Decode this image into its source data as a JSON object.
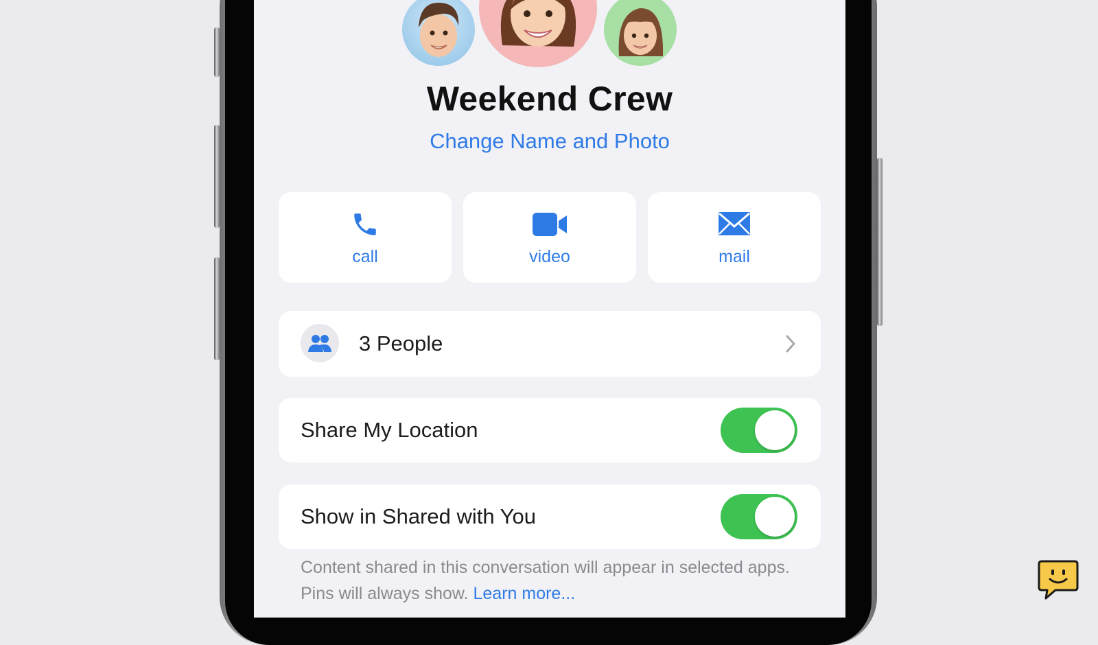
{
  "group": {
    "name": "Weekend Crew",
    "change_link": "Change Name and Photo"
  },
  "actions": [
    {
      "label": "call",
      "icon": "phone-icon"
    },
    {
      "label": "video",
      "icon": "video-camera-icon"
    },
    {
      "label": "mail",
      "icon": "envelope-icon"
    }
  ],
  "people_row": {
    "label": "3 People",
    "icon": "people-icon"
  },
  "settings": [
    {
      "label": "Share My Location",
      "enabled": true
    },
    {
      "label": "Show in Shared with You",
      "enabled": true
    }
  ],
  "footnote": {
    "text": "Content shared in this conversation will appear in selected apps. Pins will always show.",
    "link": "Learn more..."
  },
  "colors": {
    "accent": "#2f7be6",
    "toggle_on": "#3ec353",
    "background": "#f1f1f6"
  }
}
